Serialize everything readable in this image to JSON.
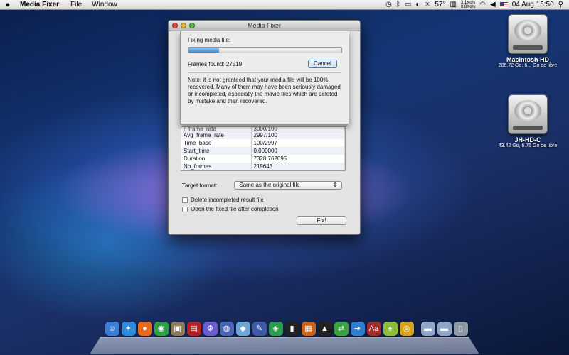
{
  "menubar": {
    "app_name": "Media Fixer",
    "menus": [
      "File",
      "Window"
    ],
    "temperature": "57°",
    "net_up": "3.1Ko/s",
    "net_down": "0.8Ko/s",
    "datetime": "04 Aug 15:50"
  },
  "desktop": {
    "drives": [
      {
        "name": "Macintosh HD",
        "size": "206.72 Go, 6... Go de libre"
      },
      {
        "name": "JH-HD-C",
        "size": "43.42 Go, 6.75 Go de libre"
      }
    ]
  },
  "window": {
    "title": "Media Fixer",
    "properties": [
      {
        "key": "r_frame_rate",
        "value": "3000/100"
      },
      {
        "key": "Avg_frame_rate",
        "value": "2997/100"
      },
      {
        "key": "Time_base",
        "value": "100/2997"
      },
      {
        "key": "Start_time",
        "value": "0.000000"
      },
      {
        "key": "Duration",
        "value": "7328.762095"
      },
      {
        "key": "Nb_frames",
        "value": "219643"
      }
    ],
    "target_format_label": "Target format:",
    "target_format_value": "Same as the original file",
    "checkbox_delete_label": "Delete incompleted result file",
    "checkbox_open_label": "Open the fixed file after completion",
    "fix_button": "Fix!"
  },
  "sheet": {
    "heading": "Fixing media file:",
    "progress_fraction": 0.2,
    "frames_found": "Frames found: 27519",
    "cancel_button": "Cancel",
    "note": "Note: it is not granteed that your media file will be 100% recovered. Many of them may have been seriously damaged or incompleted, especially the movie files which are deleted by mistake and then recovered."
  },
  "dock": {
    "icons": [
      {
        "name": "finder-icon",
        "glyph": "☺",
        "color": "#3a7fd5"
      },
      {
        "name": "safari-icon",
        "glyph": "✦",
        "color": "#2c8ad8"
      },
      {
        "name": "firefox-icon",
        "glyph": "●",
        "color": "#e66a1d"
      },
      {
        "name": "chrome-icon",
        "glyph": "◉",
        "color": "#2f9d46"
      },
      {
        "name": "preview-icon",
        "glyph": "▣",
        "color": "#8c7b5a"
      },
      {
        "name": "photobooth-icon",
        "glyph": "▤",
        "color": "#b62126"
      },
      {
        "name": "app-icon",
        "glyph": "⚙",
        "color": "#6a5acd"
      },
      {
        "name": "network-icon",
        "glyph": "◍",
        "color": "#4866b8"
      },
      {
        "name": "cube-icon",
        "glyph": "◆",
        "color": "#6fa6d8"
      },
      {
        "name": "pen-icon",
        "glyph": "✎",
        "color": "#3c5aa8"
      },
      {
        "name": "maps-icon",
        "glyph": "◈",
        "color": "#2b9c4e"
      },
      {
        "name": "terminal-icon",
        "glyph": "▮",
        "color": "#222222"
      },
      {
        "name": "box-icon",
        "glyph": "▦",
        "color": "#c9641b"
      },
      {
        "name": "media-fixer-icon",
        "glyph": "▲",
        "color": "#222222"
      },
      {
        "name": "sync-icon",
        "glyph": "⇄",
        "color": "#38a33f"
      },
      {
        "name": "forward-icon",
        "glyph": "➜",
        "color": "#2e7fd0"
      },
      {
        "name": "dictionary-icon",
        "glyph": "Aa",
        "color": "#a12a2a"
      },
      {
        "name": "android-icon",
        "glyph": "♠",
        "color": "#8bbd3b"
      },
      {
        "name": "orbit-icon",
        "glyph": "◎",
        "color": "#d8a11c"
      },
      {
        "name": "applications-folder-icon",
        "glyph": "▬",
        "color": "#8fa6c9"
      },
      {
        "name": "documents-folder-icon",
        "glyph": "▬",
        "color": "#8fa6c9"
      },
      {
        "name": "trash-icon",
        "glyph": "▯",
        "color": "#8f9aa6"
      }
    ]
  }
}
